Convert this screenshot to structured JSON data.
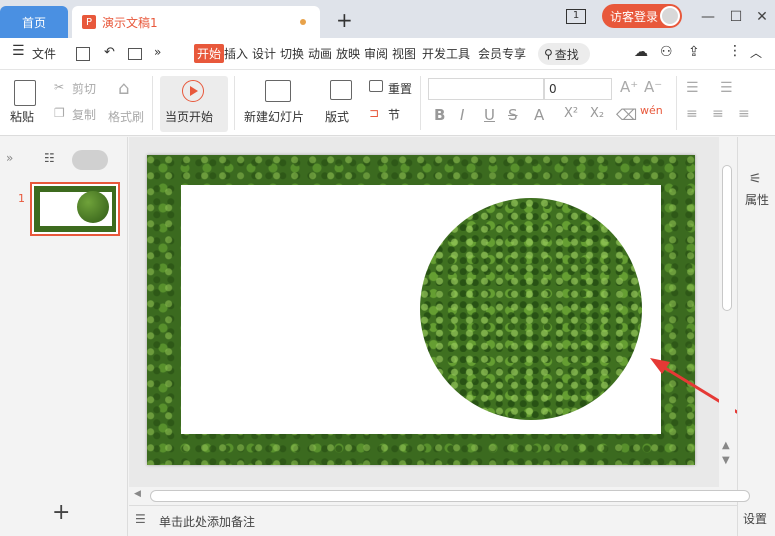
{
  "titlebar": {
    "home_tab": "首页",
    "doc_tab": "演示文稿1",
    "new_tab_symbol": "+",
    "page_count_icon_text": "1",
    "login_label": "访客登录",
    "minimize": "—",
    "maximize": "☐",
    "close": "✕"
  },
  "menubar": {
    "hamburger": "☰",
    "file": "文件",
    "more": "»",
    "items": [
      "开始",
      "插入",
      "设计",
      "切换",
      "动画",
      "放映",
      "审阅",
      "视图",
      "开发工具",
      "会员专享"
    ],
    "active_index": 0,
    "search": "查找"
  },
  "ribbon": {
    "paste": "粘贴",
    "cut": "剪切",
    "copy": "复制",
    "format_painter": "格式刷",
    "play_from_current": "当页开始",
    "new_slide": "新建幻灯片",
    "layout": "版式",
    "reset": "重置",
    "section": "节",
    "font_name": "",
    "font_size": "0",
    "bold": "B",
    "italic": "I",
    "underline": "U",
    "strike": "S",
    "font_color": "A",
    "superscript": "X²",
    "subscript": "X₂",
    "wen": "wén"
  },
  "slides_panel": {
    "collapse": "»",
    "slide_number": "1",
    "add_symbol": "+"
  },
  "notes": {
    "placeholder": "单击此处添加备注"
  },
  "side_panel": {
    "properties": "属性",
    "settings": "设置"
  },
  "colors": {
    "accent": "#e8583b",
    "home_tab": "#4a90e2"
  }
}
